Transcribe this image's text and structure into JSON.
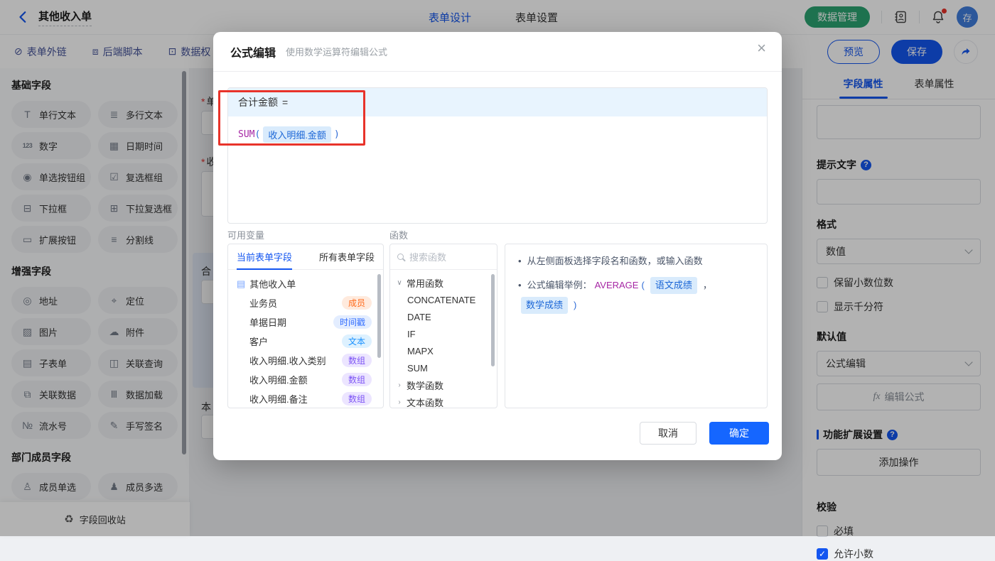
{
  "colors": {
    "accent": "#1456f0",
    "confirm_blue": "#1566ff",
    "green_button": "#2ba471",
    "annotation_red": "#e8332a",
    "formula_header_bg": "#e8f4fe",
    "chip_bg": "#d9ebfc",
    "chip_text": "#1b66d6",
    "function_name": "#a626a4",
    "badge_member": "#ff6a1b",
    "badge_timestamp": "#2e6bff",
    "badge_text": "#1890ff",
    "badge_array": "#7d54f5"
  },
  "icons": {
    "back": "chevron-left",
    "contacts": "address-book",
    "notifications": "bell-with-red-dot",
    "share": "share-arrow",
    "close": "×",
    "search": "magnifier",
    "help": "?",
    "recycle": "♻"
  },
  "topbar": {
    "title": "其他收入单",
    "nav": [
      {
        "label": "表单设计"
      },
      {
        "label": "表单设置"
      }
    ],
    "data_manage_button": "数据管理",
    "avatar_text": "存"
  },
  "toolbar": {
    "links": [
      {
        "icon": "⊘",
        "label": "表单外链"
      },
      {
        "icon": "⧈",
        "label": "后端脚本"
      },
      {
        "icon": "⊡",
        "label": "数据权"
      }
    ],
    "preview_button": "预览",
    "save_button": "保存"
  },
  "sidebar": {
    "sections": [
      {
        "title": "基础字段",
        "items": [
          {
            "icon": "T",
            "label": "单行文本"
          },
          {
            "icon": "≣",
            "label": "多行文本"
          },
          {
            "icon": "123",
            "label": "数字"
          },
          {
            "icon": "▦",
            "label": "日期时间"
          },
          {
            "icon": "◉",
            "label": "单选按钮组"
          },
          {
            "icon": "☑",
            "label": "复选框组"
          },
          {
            "icon": "⊟",
            "label": "下拉框"
          },
          {
            "icon": "⊞",
            "label": "下拉复选框"
          },
          {
            "icon": "▭",
            "label": "扩展按钮"
          },
          {
            "icon": "≡",
            "label": "分割线"
          }
        ]
      },
      {
        "title": "增强字段",
        "items": [
          {
            "icon": "◎",
            "label": "地址"
          },
          {
            "icon": "⌖",
            "label": "定位"
          },
          {
            "icon": "▨",
            "label": "图片"
          },
          {
            "icon": "☁",
            "label": "附件"
          },
          {
            "icon": "▤",
            "label": "子表单"
          },
          {
            "icon": "◫",
            "label": "关联查询"
          },
          {
            "icon": "⧉",
            "label": "关联数据"
          },
          {
            "icon": "Ⅲ",
            "label": "数据加载"
          },
          {
            "icon": "№",
            "label": "流水号"
          },
          {
            "icon": "✎",
            "label": "手写签名"
          }
        ]
      },
      {
        "title": "部门成员字段",
        "items": [
          {
            "icon": "♙",
            "label": "成员单选"
          },
          {
            "icon": "♟",
            "label": "成员多选"
          }
        ]
      }
    ],
    "recycle_bin": {
      "icon": "♻",
      "label": "字段回收站"
    }
  },
  "canvas": {
    "fields": [
      {
        "star": "*",
        "label": "单"
      },
      {
        "star": "*",
        "label": "收"
      },
      {
        "star": "",
        "label": "合"
      },
      {
        "star": "",
        "label": "本"
      }
    ]
  },
  "modal": {
    "title": "公式编辑",
    "subtitle": "使用数学运算符编辑公式",
    "close_icon": "×",
    "formula": {
      "target": "合计金额",
      "equals": "=",
      "function": "SUM",
      "open_paren": "(",
      "field_chip": "收入明细.金额",
      "close_paren": ")"
    },
    "variables": {
      "label": "可用变量",
      "tabs": [
        {
          "label": "当前表单字段"
        },
        {
          "label": "所有表单字段"
        }
      ],
      "root": {
        "icon": "▤",
        "label": "其他收入单"
      },
      "fields": [
        {
          "name": "业务员",
          "type": "成员"
        },
        {
          "name": "单据日期",
          "type": "时间戳"
        },
        {
          "name": "客户",
          "type": "文本"
        },
        {
          "name": "收入明细.收入类别",
          "type": "数组"
        },
        {
          "name": "收入明细.金额",
          "type": "数组"
        },
        {
          "name": "收入明细.备注",
          "type": "数组"
        }
      ]
    },
    "functions": {
      "label": "函数",
      "search_placeholder": "搜索函数",
      "groups": [
        {
          "chevron": "∨",
          "name": "常用函数",
          "items": [
            "CONCATENATE",
            "DATE",
            "IF",
            "MAPX",
            "SUM"
          ]
        },
        {
          "chevron": "›",
          "name": "数学函数",
          "items": []
        },
        {
          "chevron": "›",
          "name": "文本函数",
          "items": []
        }
      ]
    },
    "tips": {
      "bullet": "•",
      "line1": "从左侧面板选择字段名和函数，或输入函数",
      "line2_prefix": "公式编辑举例：",
      "example_function": "AVERAGE",
      "open_paren": "(",
      "example_chip1": "语文成绩",
      "separator": "，",
      "example_chip2": "数学成绩",
      "close_paren": ")"
    },
    "cancel_button": "取消",
    "confirm_button": "确定"
  },
  "right_panel": {
    "tabs": [
      {
        "label": "字段属性"
      },
      {
        "label": "表单属性"
      }
    ],
    "hint_label": "提示文字",
    "format_label": "格式",
    "format_value": "数值",
    "keep_decimal_checkbox": "保留小数位数",
    "thousand_separator_checkbox": "显示千分符",
    "default_label": "默认值",
    "default_value": "公式编辑",
    "edit_formula_button": {
      "icon": "fx",
      "label": "编辑公式"
    },
    "extension_section": "功能扩展设置",
    "add_action_button": "添加操作",
    "validation_label": "校验",
    "required_checkbox": "必填",
    "allow_decimal_checkbox": "允许小数"
  }
}
